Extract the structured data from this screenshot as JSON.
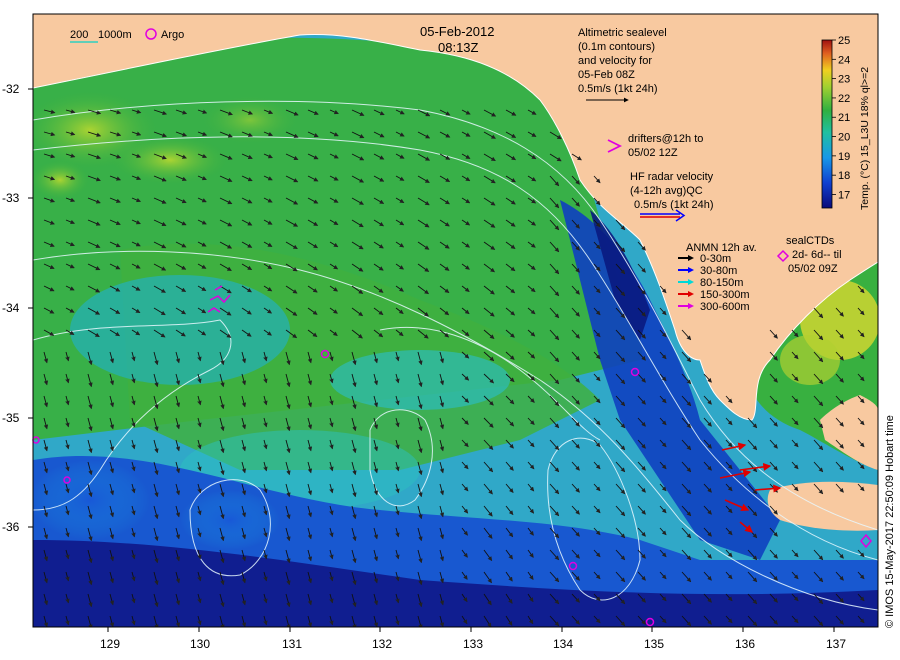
{
  "header": {
    "date": "05-Feb-2012",
    "time": "08:13Z"
  },
  "scale_legend": {
    "depth_label": "200",
    "depth_label2": "1000m",
    "argo_label": "Argo",
    "contour_color": "#2fd0c0",
    "argo_color": "#e000e0"
  },
  "altimetry": {
    "line1": "Altimetric sealevel",
    "line2": "(0.1m contours)",
    "line3": "and velocity for",
    "line4": "05-Feb 08Z",
    "line5": "0.5m/s (1kt 24h)"
  },
  "drifters": {
    "line1": "drifters@12h to",
    "line2": "05/02 12Z",
    "color": "#e000e0"
  },
  "hf_radar": {
    "line1": "HF radar velocity",
    "line2": "(4-12h avg)QC",
    "line3": "0.5m/s (1kt 24h)",
    "arrow_color_blue": "#0000ff",
    "arrow_color_red": "#e00000"
  },
  "anmn": {
    "title": "ANMN 12h av.",
    "items": [
      {
        "label": "0-30m",
        "color": "#000000"
      },
      {
        "label": "30-80m",
        "color": "#0000ff"
      },
      {
        "label": "80-150m",
        "color": "#00d8d8"
      },
      {
        "label": "150-300m",
        "color": "#e00000"
      },
      {
        "label": "300-600m",
        "color": "#e000e0"
      }
    ]
  },
  "seal_ctds": {
    "line1": "sealCTDs",
    "line2": "2d- 6d-- til",
    "line3": "05/02 09Z",
    "color": "#e000e0"
  },
  "colorbar": {
    "title": "Temp. (°C) 15_L3U 18% ql>=2",
    "ticks": [
      "25",
      "24",
      "23",
      "22",
      "21",
      "20",
      "19",
      "18",
      "17"
    ],
    "range": [
      16.3,
      25
    ]
  },
  "axes": {
    "lat_ticks": [
      "-32",
      "-33",
      "-34",
      "-35",
      "-36"
    ],
    "lon_ticks": [
      "129",
      "130",
      "131",
      "132",
      "133",
      "134",
      "135",
      "136",
      "137"
    ]
  },
  "colors": {
    "land": "#f8c9a0",
    "sst_warm": "#e8e020",
    "sst_mid": "#28b040",
    "sst_cool": "#1878e0",
    "sst_cold": "#101890"
  },
  "credit": {
    "text": "© IMOS 15-May-2017 22:50:09 Hobart time"
  }
}
